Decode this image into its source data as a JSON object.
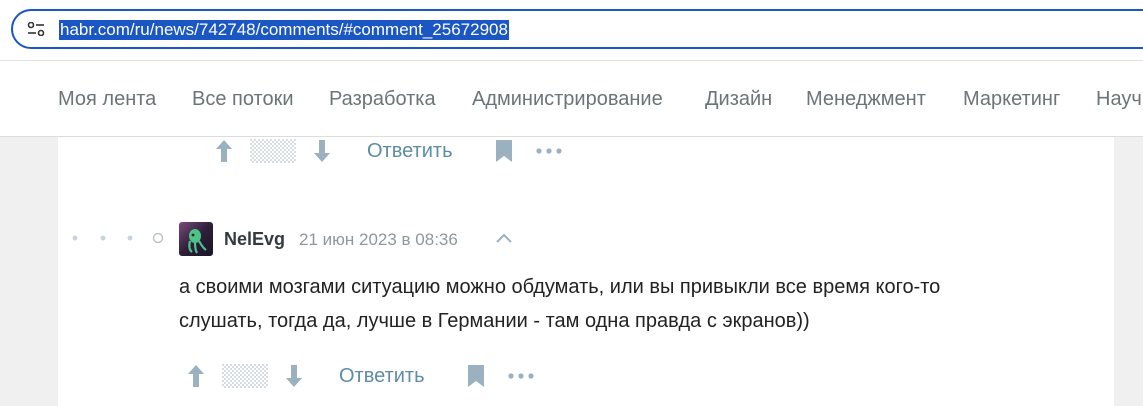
{
  "browser": {
    "url": "habr.com/ru/news/742748/comments/#comment_25672908",
    "site_settings_icon": "tune-icon"
  },
  "nav": {
    "items": [
      "Моя лента",
      "Все потоки",
      "Разработка",
      "Администрирование",
      "Дизайн",
      "Менеджмент",
      "Маркетинг",
      "Науч"
    ]
  },
  "comments": [
    {
      "reply_label": "Ответить",
      "icons": [
        "arrow-up-icon",
        "rating-hidden-icon",
        "arrow-down-icon",
        "bookmark-icon",
        "more-icon"
      ]
    },
    {
      "author": "NelEvg",
      "date": "21 июн 2023 в 08:36",
      "text_line1": "а своими мозгами ситуацию можно обдумать, или вы привыкли все время кого-то",
      "text_line2": "слушать, тогда да, лучше в Германии - там одна правда с экранов))",
      "reply_label": "Ответить",
      "icons": [
        "avatar",
        "chevron-up-icon",
        "arrow-up-icon",
        "rating-hidden-icon",
        "arrow-down-icon",
        "bookmark-icon",
        "more-icon"
      ]
    }
  ],
  "colors": {
    "accent": "#1a56c4",
    "link": "#5e8ba6",
    "icon": "#9bb1bf"
  }
}
